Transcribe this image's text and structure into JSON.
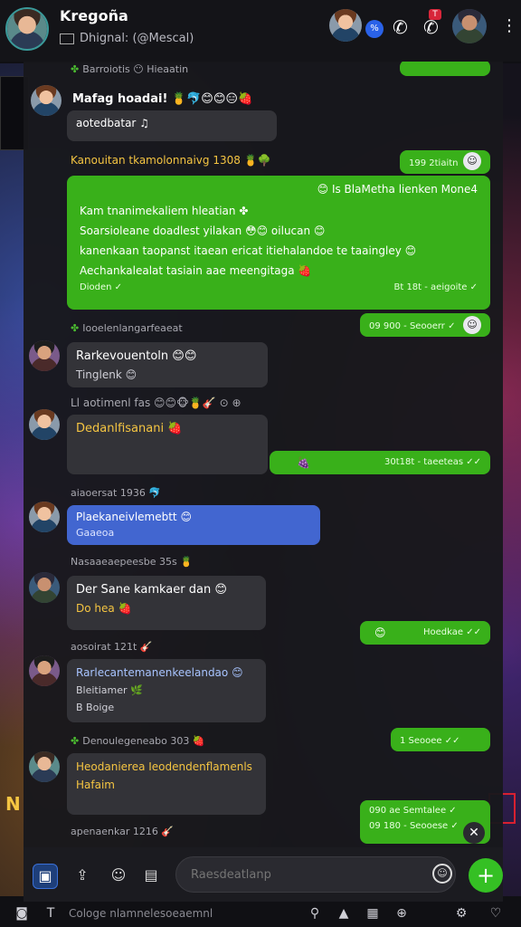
{
  "header": {
    "title": "Kregoña",
    "subtitle": "Dhignal: (@Mescal)",
    "blue_badge": "%",
    "red_badge": "T"
  },
  "messages": [
    {
      "meta": "Barroiotis 😶 Hieaatin"
    },
    {
      "name": "Mafag hoadai! 🍍🐬😊😊😑🍓",
      "text": "aotedbatar ♫"
    },
    {
      "text_left": "Kanouitan tkamolonnaivg 1308 🍍🌳",
      "ts": "199 2tiaitn"
    },
    {
      "header_line": "😊 Is  BlaMetha lienken Mone4",
      "lines": [
        "Kam tnanimekaliem hleatian ✤",
        "Soarsioleane doadlest yilakan 😳😊 oilucan 😊",
        "kanenkaan taopanst itaean ericat itiehalandoe te taaingley 😊",
        "Aechankalealat tasiain aae meengitaga 🍓"
      ],
      "footer_left": "Dioden ✓",
      "ts": "Bt 18t  - aeigoite ✓"
    },
    {
      "ts": "09 900  - Seooerr ✓"
    },
    {
      "meta": "Iooelenlangarfeaeat"
    },
    {
      "name": "Rarkevouentoln 😊😊",
      "text": "Tinglenk 😊"
    },
    {
      "meta": "Ll aotimenl fas 😊😊🐵🍍🎸 ⊙ ⊕"
    },
    {
      "name": "Dedanlfisanani 🍓"
    },
    {
      "text": "🍇",
      "ts": "30t18t  - taeeteas ✓✓"
    },
    {
      "meta": "aiaoersat 1936 🐬"
    },
    {
      "name": "Plaekaneivlemebtt 😊",
      "text": "Gaaeoa"
    },
    {
      "meta": "Nasaaeaepeesbe  35s 🍍"
    },
    {
      "name": "Der Sane kamkaer dan 😊",
      "text": "Do hea 🍓"
    },
    {
      "text": "😊",
      "ts": "Hoedkae ✓✓"
    },
    {
      "meta": "aosoirat 121t 🎸"
    },
    {
      "name": "Rarlecantemanenkeelandao 😊",
      "text": "Bleitiamer 🌿",
      "extra": "B  Boige"
    },
    {
      "meta": "Denoulegeneabo 303 🍓"
    },
    {
      "ts": "1  Seooee ✓✓"
    },
    {
      "name": "Heodanierea Ieodendenflamenls",
      "text": "Hafaim"
    },
    {
      "ts1": "090 ae Semtalee ✓",
      "ts2": "09 180  - Seooese ✓"
    },
    {
      "meta": "apenaenkar 1216 🎸"
    }
  ],
  "composer": {
    "placeholder": "Raesdeatlanp"
  },
  "bottom_bar": {
    "text": "Cologe nlamnelesoeaemnl",
    "icons": [
      "shield-icon",
      "gallery-icon",
      "sticker-icon",
      "gamepad-icon",
      "settings-icon",
      "heart-icon"
    ]
  },
  "side": {
    "n_label": "N"
  }
}
